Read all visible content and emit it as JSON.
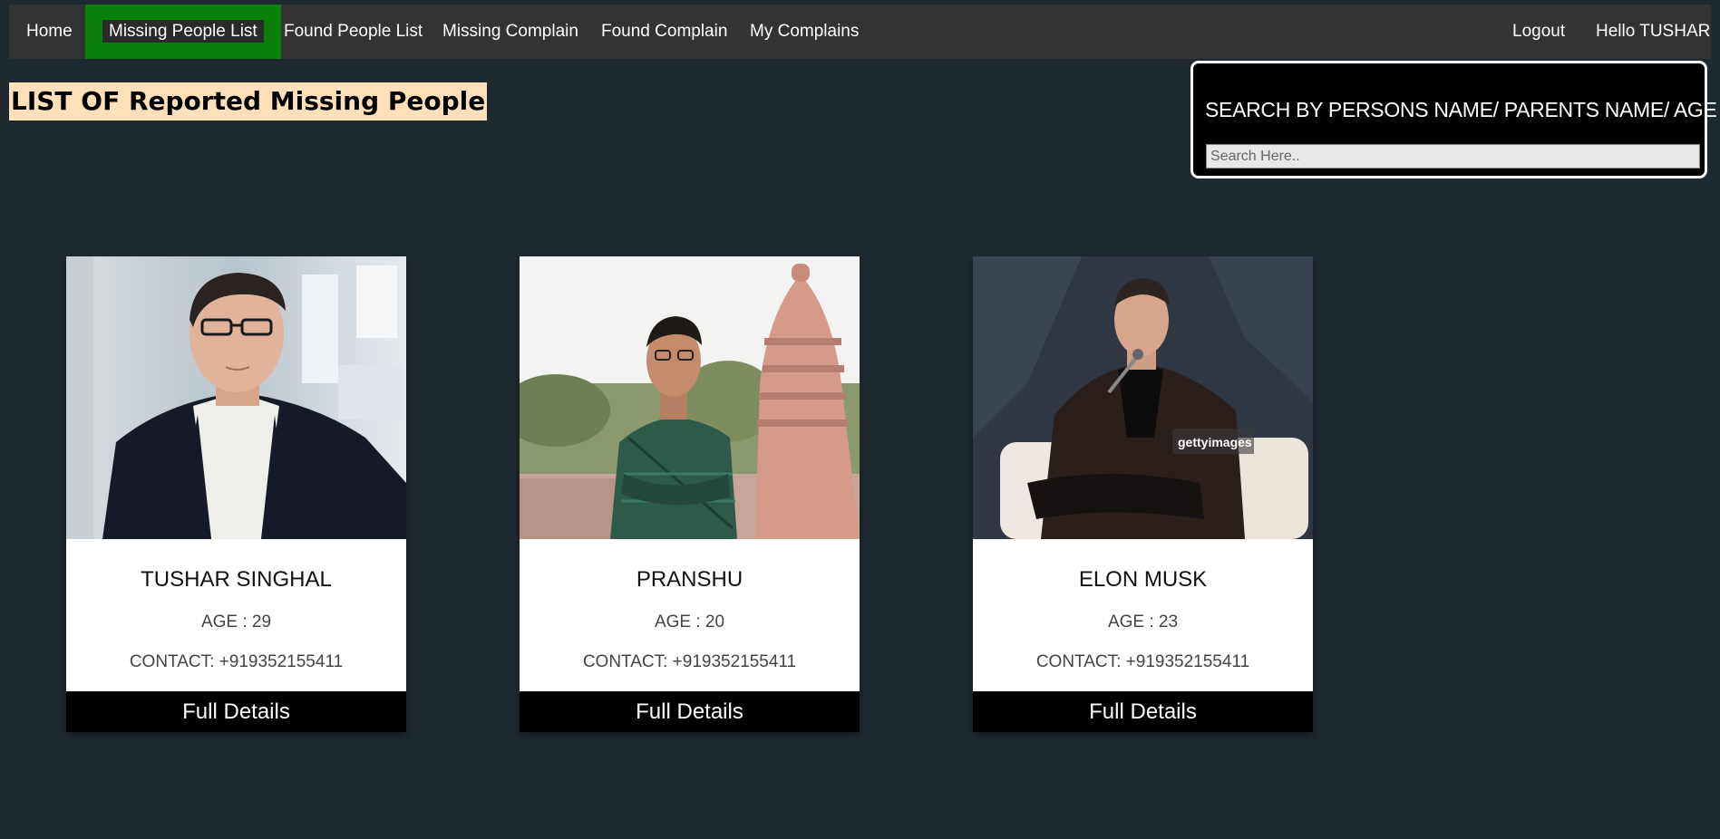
{
  "nav": {
    "home": "Home",
    "missing_people_list": "Missing People List",
    "found_people_list": "Found People List",
    "missing_complain": "Missing Complain",
    "found_complain": "Found Complain",
    "my_complains": "My Complains",
    "logout": "Logout",
    "greeting": "Hello TUSHAR",
    "active_color": "#0a7f0a"
  },
  "page": {
    "title": "LIST OF Reported Missing People",
    "title_bg": "#ffe0b8"
  },
  "search": {
    "title": "SEARCH BY PERSONS NAME/ PARENTS NAME/ AGE",
    "placeholder": "Search Here..",
    "value": ""
  },
  "cards": [
    {
      "photo": "man-in-suit-photo",
      "name": "TUSHAR SINGHAL",
      "age": "AGE : 29",
      "contact": "CONTACT: +919352155411",
      "button": "Full Details"
    },
    {
      "photo": "young-man-at-temple-photo",
      "name": "PRANSHU",
      "age": "AGE : 20",
      "contact": "CONTACT: +919352155411",
      "button": "Full Details"
    },
    {
      "photo": "man-with-microphone-photo",
      "watermark": "gettyimages",
      "name": "ELON MUSK",
      "age": "AGE : 23",
      "contact": "CONTACT: +919352155411",
      "button": "Full Details"
    }
  ]
}
